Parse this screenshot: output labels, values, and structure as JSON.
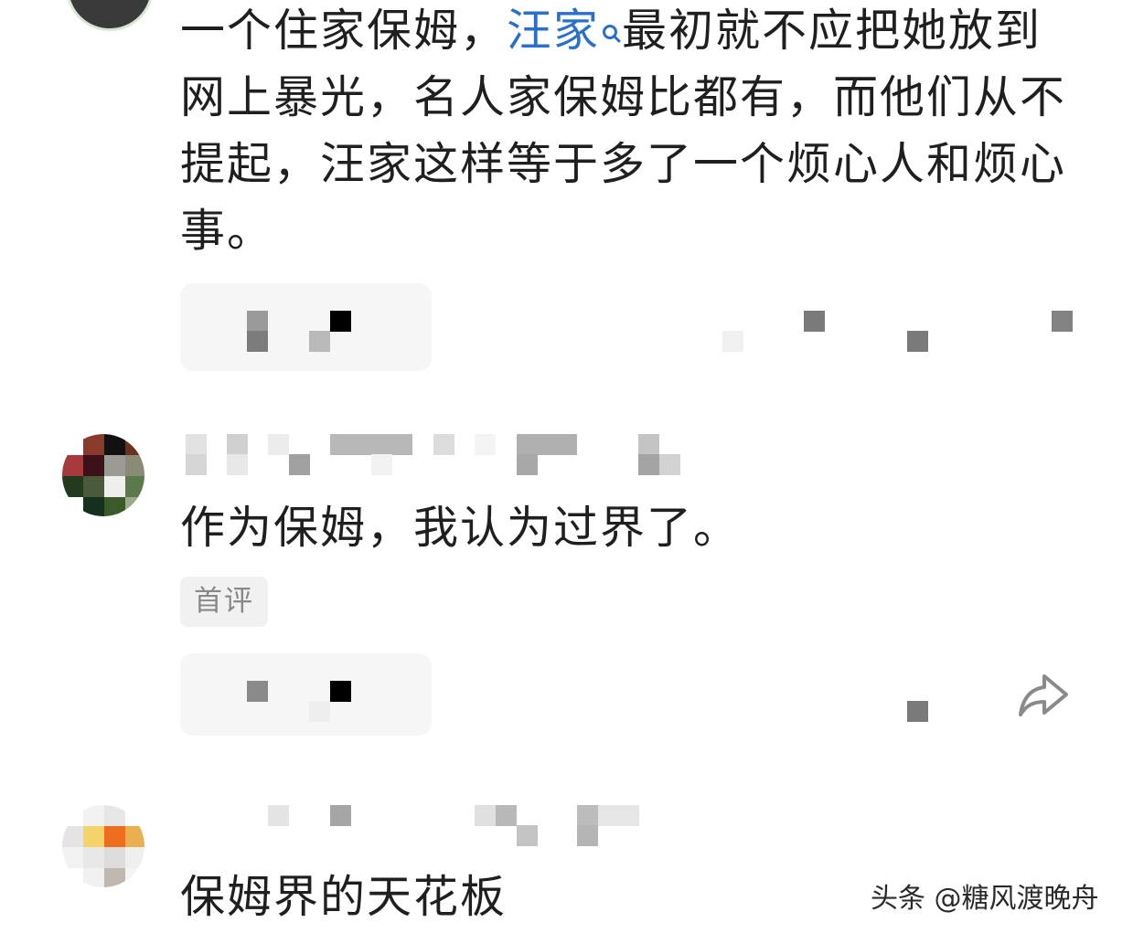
{
  "comments": [
    {
      "text_before_link": "一个住家保姆，",
      "link_text": "汪家",
      "text_after_link": "最初就不应把她放到网上暴光，名人家保姆比都有，而他们从不提起，汪家这样等于多了一个烦心人和烦心事。"
    },
    {
      "text": "作为保姆，我认为过界了。",
      "badge": "首评"
    },
    {
      "text": "保姆界的天花板"
    }
  ],
  "watermark": "头条 @糖风渡晚舟",
  "icons": {
    "search": "search-icon",
    "share": "share-icon"
  },
  "colors": {
    "link": "#2a6fcb",
    "text": "#1f1f1f",
    "badge_text": "#888888",
    "badge_bg": "#f1f1f1"
  }
}
